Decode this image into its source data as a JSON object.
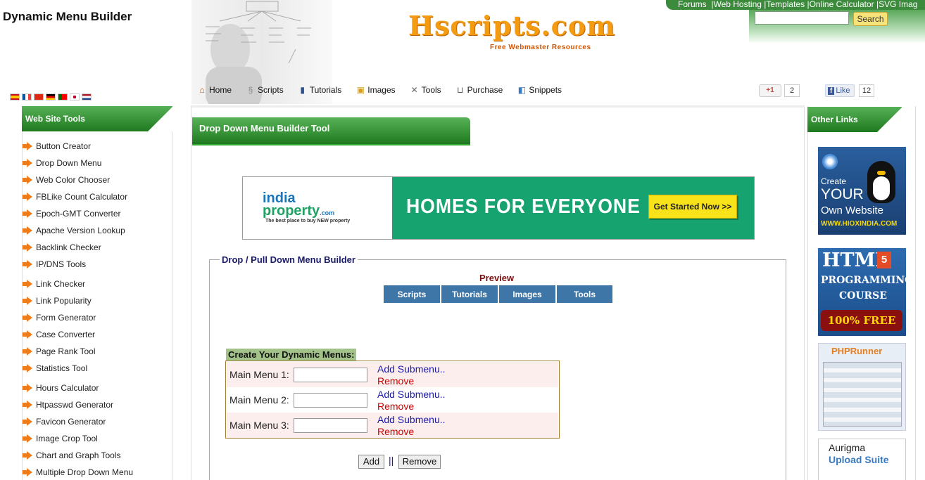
{
  "page": {
    "title": "Dynamic Menu Builder"
  },
  "logo": {
    "text": "Hscripts.com",
    "tagline": "Free Webmaster Resources"
  },
  "toplinks": [
    "Forums",
    "|Web Hosting",
    "|Templates",
    "|Online Calculator",
    "|SVG Imag"
  ],
  "search": {
    "button_label": "Search",
    "placeholder": ""
  },
  "flags": [
    "#c60b1e",
    "#0055a4",
    "#de2910",
    "#000000",
    "#006600",
    "#bc002d",
    "#21468b"
  ],
  "nav": {
    "items": [
      {
        "label": "Home",
        "icon": "home-icon"
      },
      {
        "label": "Scripts",
        "icon": "scripts-icon"
      },
      {
        "label": "Tutorials",
        "icon": "book-icon"
      },
      {
        "label": "Images",
        "icon": "image-icon"
      },
      {
        "label": "Tools",
        "icon": "tools-icon"
      },
      {
        "label": "Purchase",
        "icon": "cart-icon"
      },
      {
        "label": "Snippets",
        "icon": "snippets-icon"
      }
    ]
  },
  "social": {
    "gplus_label": "+1",
    "gplus_count": "2",
    "fb_label": "Like",
    "fb_count": "12"
  },
  "left": {
    "heading": "Web Site Tools",
    "items": [
      "Button Creator",
      "Drop Down Menu",
      "Web Color Chooser",
      "FBLike Count Calculator",
      "Epoch-GMT Converter",
      "Apache Version Lookup",
      "Backlink Checker",
      "IP/DNS Tools",
      "Link Checker",
      "Link Popularity",
      "Form Generator",
      "Case Converter",
      "Page Rank Tool",
      "Statistics Tool",
      "Hours Calculator",
      "Htpasswd Generator",
      "Favicon Generator",
      "Image Crop Tool",
      "Chart and Graph Tools",
      "Multiple Drop Down Menu"
    ]
  },
  "main": {
    "heading": "Drop Down Menu Builder Tool",
    "ad": {
      "brand1": "india",
      "brand2": "property",
      "brand_suffix": ".com",
      "brand_tag": "The best place to buy NEW property",
      "slogan": "HOMES FOR EVERYONE",
      "cta": "Get Started Now >>"
    },
    "builder": {
      "legend": "Drop / Pull Down Menu Builder",
      "preview_label": "Preview",
      "preview_menus": [
        "Scripts",
        "Tutorials",
        "Images",
        "Tools"
      ],
      "create_label": "Create Your Dynamic Menus:",
      "rows": [
        {
          "label": "Main Menu 1:",
          "value": "",
          "add": "Add Submenu..",
          "remove": "Remove"
        },
        {
          "label": "Main Menu 2:",
          "value": "",
          "add": "Add Submenu..",
          "remove": "Remove"
        },
        {
          "label": "Main Menu 3:",
          "value": "",
          "add": "Add Submenu..",
          "remove": "Remove"
        }
      ],
      "add_button": "Add",
      "separator": "||",
      "remove_button": "Remove"
    }
  },
  "right": {
    "heading": "Other Links",
    "ads": [
      {
        "lines": [
          "Create",
          "YOUR",
          "Own Website",
          "WWW.HIOXINDIA.COM"
        ]
      },
      {
        "lines": [
          "HTML",
          "5",
          "PROGRAMMING",
          "COURSE",
          "100% FREE"
        ]
      },
      {
        "lines": [
          "PHPRunner"
        ]
      },
      {
        "lines": [
          "Aurigma",
          "Upload Suite"
        ]
      }
    ]
  },
  "colors": {
    "green_dark": "#1f7a1f",
    "green_light": "#56b056",
    "orange": "#f07d1a",
    "preview_blue": "#3f76a8"
  }
}
